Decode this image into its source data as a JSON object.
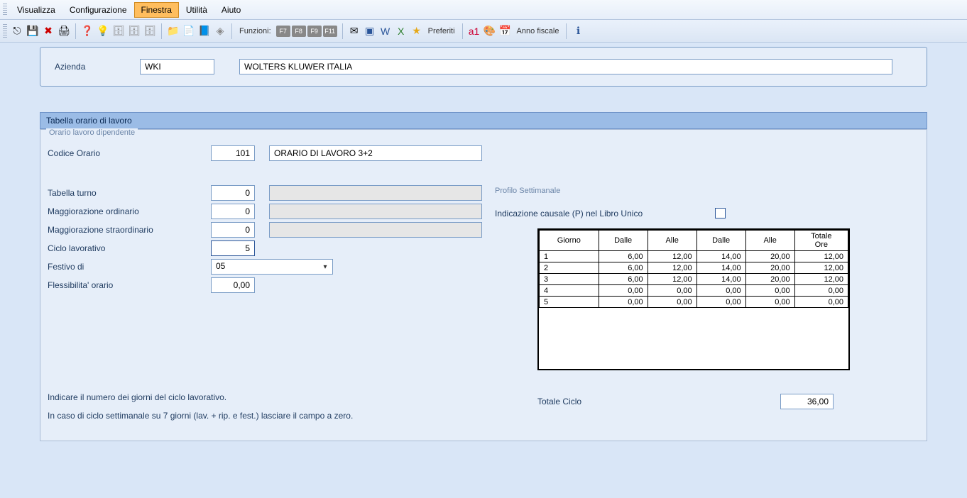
{
  "menu": {
    "items": [
      "Visualizza",
      "Configurazione",
      "Finestra",
      "Utilità",
      "Aiuto"
    ],
    "active_index": 2
  },
  "toolbar": {
    "funzioni_label": "Funzioni:",
    "fkeys": [
      "F7",
      "F8",
      "F9",
      "F11"
    ],
    "preferiti_label": "Preferiti",
    "anno_fiscale_label": "Anno fiscale"
  },
  "header": {
    "azienda_label": "Azienda",
    "azienda_code": "WKI",
    "azienda_name": "WOLTERS KLUWER ITALIA"
  },
  "panel": {
    "title": "Tabella orario di lavoro",
    "group_label": "Orario lavoro dipendente",
    "codice_label": "Codice Orario",
    "codice_value": "101",
    "codice_desc": "ORARIO DI LAVORO 3+2",
    "tabella_turno_label": "Tabella turno",
    "tabella_turno_value": "0",
    "magg_ord_label": "Maggiorazione ordinario",
    "magg_ord_value": "0",
    "magg_str_label": "Maggiorazione straordinario",
    "magg_str_value": "0",
    "ciclo_label": "Ciclo lavorativo",
    "ciclo_value": "5",
    "festivo_label": "Festivo di",
    "festivo_value": "05",
    "fless_label": "Flessibilita' orario",
    "fless_value": "0,00",
    "help1": "Indicare il numero dei giorni del ciclo lavorativo.",
    "help2": "In caso di ciclo settimanale su 7 giorni (lav. + rip. e fest.) lasciare il campo a zero."
  },
  "profile": {
    "title": "Profilo Settimanale",
    "causale_label": "Indicazione causale (P) nel Libro Unico",
    "headers": [
      "Giorno",
      "Dalle",
      "Alle",
      "Dalle",
      "Alle",
      "Totale Ore"
    ],
    "rows": [
      {
        "g": "1",
        "d1": "6,00",
        "a1": "12,00",
        "d2": "14,00",
        "a2": "20,00",
        "t": "12,00"
      },
      {
        "g": "2",
        "d1": "6,00",
        "a1": "12,00",
        "d2": "14,00",
        "a2": "20,00",
        "t": "12,00"
      },
      {
        "g": "3",
        "d1": "6,00",
        "a1": "12,00",
        "d2": "14,00",
        "a2": "20,00",
        "t": "12,00"
      },
      {
        "g": "4",
        "d1": "0,00",
        "a1": "0,00",
        "d2": "0,00",
        "a2": "0,00",
        "t": "0,00"
      },
      {
        "g": "5",
        "d1": "0,00",
        "a1": "0,00",
        "d2": "0,00",
        "a2": "0,00",
        "t": "0,00"
      }
    ],
    "totale_label": "Totale Ciclo",
    "totale_value": "36,00"
  }
}
